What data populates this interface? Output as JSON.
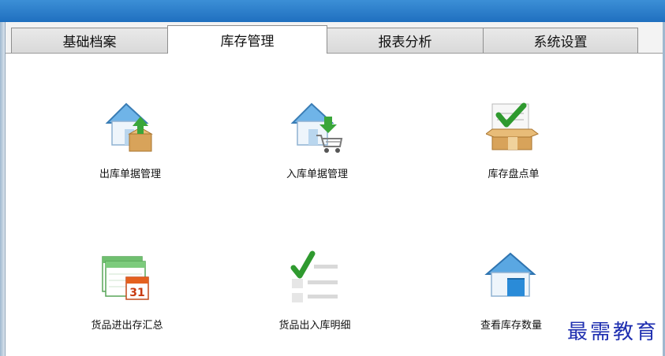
{
  "tabs": [
    {
      "label": "基础档案",
      "active": false
    },
    {
      "label": "库存管理",
      "active": true
    },
    {
      "label": "报表分析",
      "active": false
    },
    {
      "label": "系统设置",
      "active": false
    }
  ],
  "tiles": [
    {
      "label": "出库单据管理",
      "icon": "warehouse-out-icon"
    },
    {
      "label": "入库单据管理",
      "icon": "warehouse-in-cart-icon"
    },
    {
      "label": "库存盘点单",
      "icon": "box-check-icon"
    },
    {
      "label": "货品进出存汇总",
      "icon": "calendar-report-icon"
    },
    {
      "label": "货品出入库明细",
      "icon": "checklist-icon"
    },
    {
      "label": "查看库存数量",
      "icon": "warehouse-icon"
    }
  ],
  "watermark": "最需教育",
  "colors": {
    "title_bar": "#1f6fbf",
    "watermark": "#1f2fb0",
    "accent_green": "#3aa63a"
  }
}
